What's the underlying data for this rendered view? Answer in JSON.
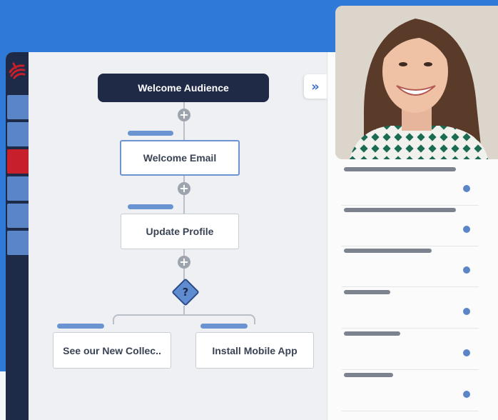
{
  "flow": {
    "start_node": "Welcome Audience",
    "steps": [
      "Welcome Email",
      "Update Profile"
    ],
    "decision_symbol": "?",
    "branches": [
      "See our New Collec..",
      "Install Mobile App"
    ],
    "add_symbol": "+"
  },
  "panel": {
    "collapse_symbol": "»",
    "row_count": 6,
    "row_fill": [
      0.82,
      0.82,
      0.64,
      0.34,
      0.41,
      0.36
    ]
  },
  "colors": {
    "brand_blue": "#2f7ad8",
    "nav_dark": "#1d2a48",
    "accent_red": "#c8202b",
    "node_accent": "#6a93d2"
  },
  "icons": [
    "logo-icon",
    "plus-icon",
    "decision-icon",
    "collapse-icon",
    "avatar-photo"
  ]
}
